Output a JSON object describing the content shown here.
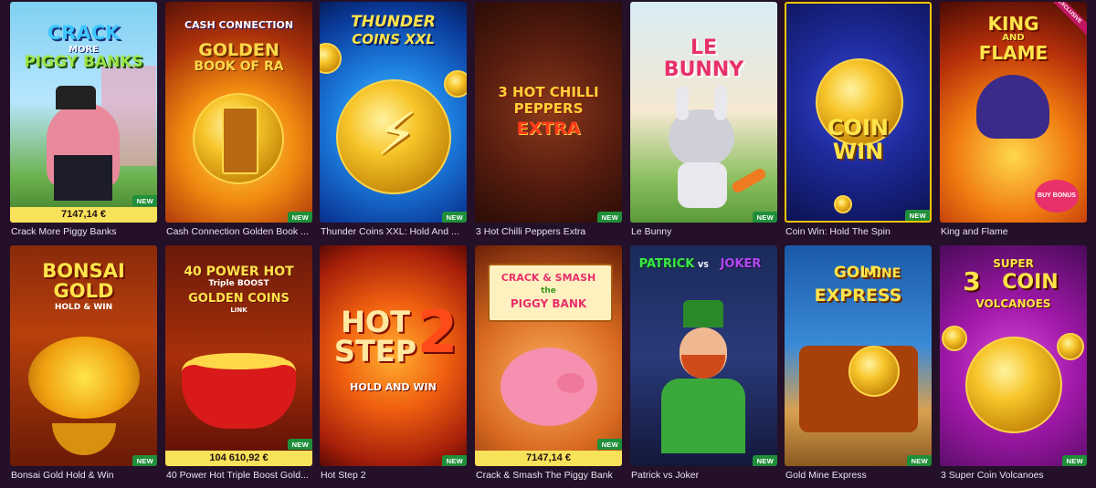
{
  "games": [
    {
      "title": "Crack More Piggy Banks",
      "new": true,
      "jackpot": "7147,14 €",
      "art": [
        "CRACK",
        "MORE",
        "PIGGY BANKS"
      ]
    },
    {
      "title": "Cash Connection Golden Book ...",
      "new": true,
      "art": [
        "CASH CONNECTION",
        "GOLDEN",
        "BOOK OF RA"
      ]
    },
    {
      "title": "Thunder Coins XXL: Hold And ...",
      "new": true,
      "art": [
        "THUNDER",
        "COINS XXL"
      ]
    },
    {
      "title": "3 Hot Chilli Peppers Extra",
      "new": true,
      "art": [
        "3 HOT CHILLI",
        "PEPPERS",
        "EXTRA"
      ]
    },
    {
      "title": "Le Bunny",
      "new": true,
      "art": [
        "LE",
        "BUNNY"
      ]
    },
    {
      "title": "Coin Win: Hold The Spin",
      "new": true,
      "art": [
        "COIN",
        "WIN"
      ]
    },
    {
      "title": "King and Flame",
      "exclusive": "EXCLUSIVE",
      "art": [
        "KING",
        "AND",
        "FLAME"
      ],
      "buy_bonus": "BUY BONUS"
    },
    {
      "title": "Bonsai Gold Hold & Win",
      "new": true,
      "art": [
        "BONSAI",
        "GOLD",
        "HOLD & WIN"
      ]
    },
    {
      "title": "40 Power Hot Triple Boost Gold...",
      "new": true,
      "jackpot": "104 610,92 €",
      "art": [
        "40 POWER HOT",
        "Triple BOOST",
        "GOLDEN COINS",
        "LINK"
      ]
    },
    {
      "title": "Hot Step 2",
      "new": true,
      "art": [
        "HOT",
        "STEP",
        "2",
        "HOLD AND WIN"
      ]
    },
    {
      "title": "Crack & Smash The Piggy Bank",
      "new": true,
      "jackpot": "7147,14 €",
      "art": [
        "CRACK & SMASH",
        "the",
        "PIGGY BANK"
      ]
    },
    {
      "title": "Patrick vs Joker",
      "new": true,
      "art": [
        "PATRICK",
        "VS",
        "JOKER"
      ]
    },
    {
      "title": "Gold Mine Express",
      "new": true,
      "art": [
        "GOLD",
        "MINE",
        "EXPRESS"
      ]
    },
    {
      "title": "3 Super Coin Volcanoes",
      "new": true,
      "art": [
        "SUPER",
        "3",
        "COIN",
        "VOLCANOES"
      ]
    }
  ],
  "labels": {
    "new": "NEW"
  }
}
